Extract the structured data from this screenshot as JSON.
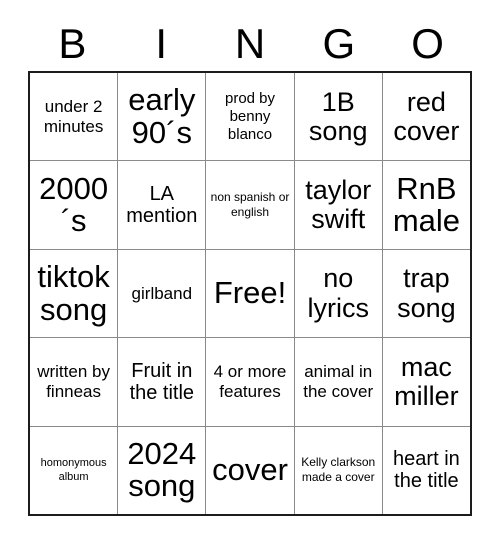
{
  "card": {
    "title": "BINGO",
    "header_letters": [
      "B",
      "I",
      "N",
      "G",
      "O"
    ],
    "free_space": "Free!",
    "colors": {
      "background": "#ffffff",
      "text": "#000000",
      "outer_border": "#1c1c1c",
      "inner_border": "#8a8a8a"
    },
    "rows": [
      [
        {
          "text": "under 2 minutes",
          "size": "sm"
        },
        {
          "text": "early 90´s",
          "size": "xxl"
        },
        {
          "text": "prod by benny blanco",
          "size": "xs"
        },
        {
          "text": "1B song",
          "size": "xl"
        },
        {
          "text": "red cover",
          "size": "xl"
        }
      ],
      [
        {
          "text": "2000´s",
          "size": "xxl"
        },
        {
          "text": "LA mention",
          "size": "md"
        },
        {
          "text": "non spanish or english",
          "size": "xxs"
        },
        {
          "text": "taylor swift",
          "size": "xl"
        },
        {
          "text": "RnB male",
          "size": "xxl"
        }
      ],
      [
        {
          "text": "tiktok song",
          "size": "xxl"
        },
        {
          "text": "girlband",
          "size": "sm"
        },
        {
          "text": "Free!",
          "size": "xxl"
        },
        {
          "text": "no lyrics",
          "size": "xl"
        },
        {
          "text": "trap song",
          "size": "xl"
        }
      ],
      [
        {
          "text": "written by finneas",
          "size": "sm"
        },
        {
          "text": "Fruit in the title",
          "size": "md"
        },
        {
          "text": "4 or more features",
          "size": "sm"
        },
        {
          "text": "animal in the cover",
          "size": "sm"
        },
        {
          "text": "mac miller",
          "size": "xl"
        }
      ],
      [
        {
          "text": "homonymous album",
          "size": "min"
        },
        {
          "text": "2024 song",
          "size": "xxl"
        },
        {
          "text": "cover",
          "size": "xxl"
        },
        {
          "text": "Kelly clarkson made a cover",
          "size": "xxs"
        },
        {
          "text": "heart in the title",
          "size": "md"
        }
      ]
    ]
  }
}
